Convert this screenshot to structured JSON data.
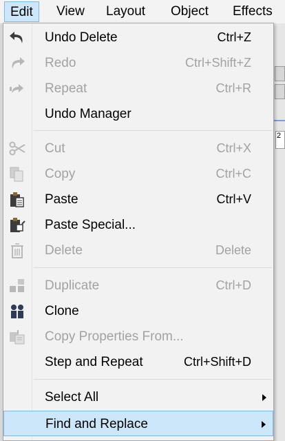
{
  "menubar": {
    "items": [
      {
        "label": "Edit",
        "mnemonic": "E"
      },
      {
        "label": "View",
        "mnemonic": "V"
      },
      {
        "label": "Layout",
        "mnemonic": "L"
      },
      {
        "label": "Object",
        "mnemonic": "O"
      },
      {
        "label": "Effects",
        "mnemonic": "c"
      }
    ]
  },
  "background": {
    "ruler_text": "2"
  },
  "edit_menu": {
    "items": [
      {
        "label": "Undo Delete",
        "shortcut": "Ctrl+Z",
        "enabled": true,
        "icon": "undo-icon"
      },
      {
        "label": "Redo",
        "shortcut": "Ctrl+Shift+Z",
        "enabled": false,
        "icon": "redo-icon"
      },
      {
        "label": "Repeat",
        "shortcut": "Ctrl+R",
        "enabled": false,
        "icon": "repeat-icon"
      },
      {
        "label": "Undo Manager",
        "shortcut": "",
        "enabled": true,
        "icon": ""
      },
      {
        "label": "Cut",
        "shortcut": "Ctrl+X",
        "enabled": false,
        "icon": "scissors-icon"
      },
      {
        "label": "Copy",
        "shortcut": "Ctrl+C",
        "enabled": false,
        "icon": "copy-icon"
      },
      {
        "label": "Paste",
        "shortcut": "Ctrl+V",
        "enabled": true,
        "icon": "paste-icon"
      },
      {
        "label": "Paste Special...",
        "shortcut": "",
        "enabled": true,
        "icon": "paste-special-icon"
      },
      {
        "label": "Delete",
        "shortcut": "Delete",
        "enabled": false,
        "icon": "trash-icon"
      },
      {
        "label": "Duplicate",
        "shortcut": "Ctrl+D",
        "enabled": false,
        "icon": "duplicate-icon"
      },
      {
        "label": "Clone",
        "shortcut": "",
        "enabled": true,
        "icon": "clone-icon"
      },
      {
        "label": "Copy Properties From...",
        "shortcut": "",
        "enabled": false,
        "icon": "copy-properties-icon"
      },
      {
        "label": "Step and Repeat",
        "shortcut": "Ctrl+Shift+D",
        "enabled": true,
        "icon": ""
      },
      {
        "label": "Select All",
        "shortcut": "",
        "enabled": true,
        "icon": "",
        "submenu": true
      },
      {
        "label": "Find and Replace",
        "shortcut": "",
        "enabled": true,
        "icon": "",
        "submenu": true,
        "selected": true
      }
    ]
  },
  "colors": {
    "highlight": "#cce6fa",
    "highlight_border": "#7fb7e6",
    "disabled_text": "#a2a2a2",
    "icon_dark": "#3c3c3c",
    "icon_disabled": "#b8b8b8"
  }
}
